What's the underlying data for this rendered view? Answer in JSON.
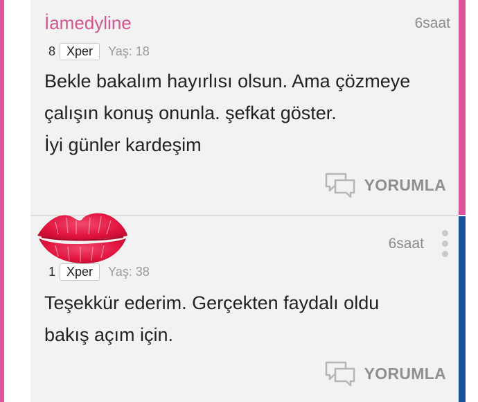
{
  "comments": [
    {
      "username": "İamedyline",
      "time": "6saat",
      "xper_count": "8",
      "xper_label": "Xper",
      "age": "Yaş: 18",
      "lines": [
        "Bekle bakalım hayırlısı olsun. Ama çözmeye",
        "çalışın konuş onunla. şefkat göster.",
        "İyi günler kardeşim"
      ],
      "reply_label": "YORUMLA"
    },
    {
      "username": "",
      "time": "6saat",
      "xper_count": "1",
      "xper_label": "Xper",
      "age": "Yaş: 38",
      "lines": [
        "Teşekkür ederim. Gerçekten faydalı oldu",
        "bakış açım için."
      ],
      "reply_label": "YORUMLA"
    }
  ],
  "colors": {
    "accent_pink": "#e0539a",
    "accent_blue": "#17539d",
    "username_pink": "#d6548f",
    "lips_red": "#e2153f"
  },
  "icons": {
    "reply": "speech-bubbles-icon",
    "more": "kebab-menu-icon",
    "sticker": "lips-kiss-icon"
  }
}
